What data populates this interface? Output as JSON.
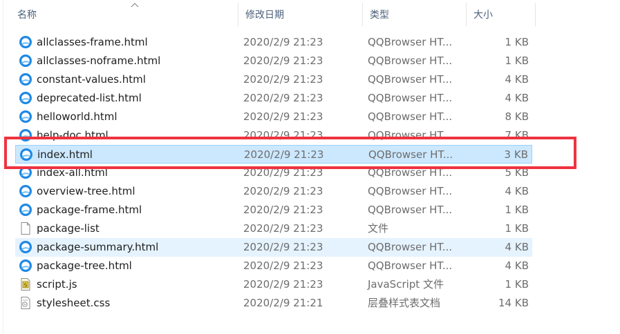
{
  "columns": {
    "name": "名称",
    "modified": "修改日期",
    "type": "类型",
    "size": "大小"
  },
  "colors": {
    "selected_bg": "#cce8ff",
    "hover_bg": "#e5f3ff",
    "annotation": "#ef3340",
    "browser_icon": "#1e88e5"
  },
  "files": [
    {
      "name": "allclasses-frame.html",
      "date": "2020/2/9 21:23",
      "type": "QQBrowser HT...",
      "size": "1 KB",
      "icon": "browser-file-icon"
    },
    {
      "name": "allclasses-noframe.html",
      "date": "2020/2/9 21:23",
      "type": "QQBrowser HT...",
      "size": "1 KB",
      "icon": "browser-file-icon"
    },
    {
      "name": "constant-values.html",
      "date": "2020/2/9 21:23",
      "type": "QQBrowser HT...",
      "size": "4 KB",
      "icon": "browser-file-icon"
    },
    {
      "name": "deprecated-list.html",
      "date": "2020/2/9 21:23",
      "type": "QQBrowser HT...",
      "size": "4 KB",
      "icon": "browser-file-icon"
    },
    {
      "name": "helloworld.html",
      "date": "2020/2/9 21:23",
      "type": "QQBrowser HT...",
      "size": "8 KB",
      "icon": "browser-file-icon"
    },
    {
      "name": "help-doc.html",
      "date": "2020/2/9 21:23",
      "type": "QQBrowser HT...",
      "size": "7 KB",
      "icon": "browser-file-icon"
    },
    {
      "name": "index.html",
      "date": "2020/2/9 21:23",
      "type": "QQBrowser HT...",
      "size": "3 KB",
      "icon": "browser-file-icon",
      "selected": true
    },
    {
      "name": "index-all.html",
      "date": "2020/2/9 21:23",
      "type": "QQBrowser HT...",
      "size": "5 KB",
      "icon": "browser-file-icon"
    },
    {
      "name": "overview-tree.html",
      "date": "2020/2/9 21:23",
      "type": "QQBrowser HT...",
      "size": "4 KB",
      "icon": "browser-file-icon"
    },
    {
      "name": "package-frame.html",
      "date": "2020/2/9 21:23",
      "type": "QQBrowser HT...",
      "size": "1 KB",
      "icon": "browser-file-icon"
    },
    {
      "name": "package-list",
      "date": "2020/2/9 21:23",
      "type": "文件",
      "size": "1 KB",
      "icon": "blank-file-icon"
    },
    {
      "name": "package-summary.html",
      "date": "2020/2/9 21:23",
      "type": "QQBrowser HT...",
      "size": "4 KB",
      "icon": "browser-file-icon",
      "hover": true
    },
    {
      "name": "package-tree.html",
      "date": "2020/2/9 21:23",
      "type": "QQBrowser HT...",
      "size": "4 KB",
      "icon": "browser-file-icon"
    },
    {
      "name": "script.js",
      "date": "2020/2/9 21:23",
      "type": "JavaScript 文件",
      "size": "1 KB",
      "icon": "script-file-icon"
    },
    {
      "name": "stylesheet.css",
      "date": "2020/2/9 21:21",
      "type": "层叠样式表文档",
      "size": "14 KB",
      "icon": "css-file-icon"
    }
  ]
}
